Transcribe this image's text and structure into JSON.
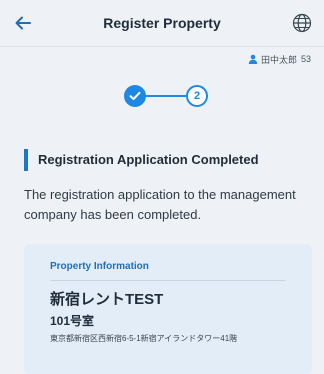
{
  "header": {
    "title": "Register Property",
    "back_icon": "arrow-left-icon",
    "language_icon": "globe-icon"
  },
  "user": {
    "icon": "person-icon",
    "name": "田中太郎",
    "id": "53"
  },
  "stepper": {
    "steps": [
      {
        "state": "completed",
        "icon": "check-icon"
      },
      {
        "state": "current",
        "label": "2"
      }
    ]
  },
  "section": {
    "title": "Registration Application Completed",
    "description": "The registration application to the management company has been completed."
  },
  "property_card": {
    "label": "Property Information",
    "name": "新宿レントTEST",
    "room": "101号室",
    "address": "東京都新宿区西新宿6-5-1新宿アイランドタワー41階"
  },
  "colors": {
    "accent": "#1e88e5",
    "section_bar": "#1e78c8",
    "card_bg": "#e3edf8",
    "page_bg": "#eef2f7"
  }
}
